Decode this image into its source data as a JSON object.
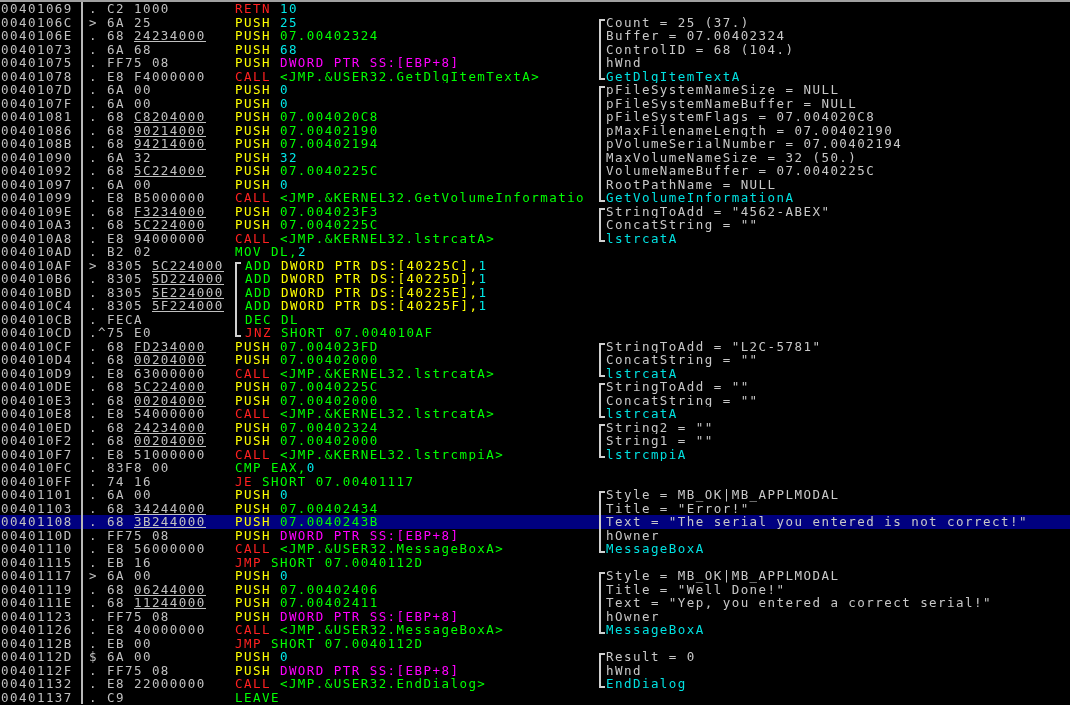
{
  "rows": [
    {
      "address": "00401069",
      "mark": ".",
      "opcode": "C2",
      "bytes": "1000",
      "mnemonic": "RETN",
      "kind": "ret",
      "operand": [
        {
          "text": "10",
          "kind": "const"
        }
      ],
      "selected": false
    },
    {
      "address": "0040106C",
      "mark": ">",
      "opcode": "6A",
      "bytes": "25",
      "mnemonic": "PUSH",
      "kind": "push",
      "operand": [
        {
          "text": "25",
          "kind": "const"
        }
      ],
      "comment": {
        "text": "Count = 25 (37.)",
        "kind": "arg"
      },
      "selected": false
    },
    {
      "address": "0040106E",
      "mark": ".",
      "opcode": "68",
      "bytes": "24234000",
      "fixup": true,
      "mnemonic": "PUSH",
      "kind": "push",
      "operand": [
        {
          "text": "07.00402324",
          "kind": "addr"
        }
      ],
      "comment": {
        "text": "Buffer = 07.00402324",
        "kind": "arg"
      },
      "selected": false
    },
    {
      "address": "00401073",
      "mark": ".",
      "opcode": "6A",
      "bytes": "68",
      "mnemonic": "PUSH",
      "kind": "push",
      "operand": [
        {
          "text": "68",
          "kind": "const"
        }
      ],
      "comment": {
        "text": "ControlID = 68 (104.)",
        "kind": "arg"
      },
      "selected": false
    },
    {
      "address": "00401075",
      "mark": ".",
      "opcode": "FF75",
      "bytes": "08",
      "mnemonic": "PUSH",
      "kind": "push",
      "operand": [
        {
          "text": "DWORD PTR SS:[EBP+8]",
          "kind": "stack"
        }
      ],
      "comment": {
        "text": "hWnd",
        "kind": "arg"
      },
      "selected": false
    },
    {
      "address": "00401078",
      "mark": ".",
      "opcode": "E8",
      "bytes": "F4000000",
      "mnemonic": "CALL",
      "kind": "call",
      "operand": [
        {
          "text": "<JMP.&USER32.GetDlgItemTextA>",
          "kind": "addr"
        }
      ],
      "comment": {
        "text": "GetDlgItemTextA",
        "kind": "func"
      },
      "selected": false
    },
    {
      "address": "0040107D",
      "mark": ".",
      "opcode": "6A",
      "bytes": "00",
      "mnemonic": "PUSH",
      "kind": "push",
      "operand": [
        {
          "text": "0",
          "kind": "const"
        }
      ],
      "comment": {
        "text": "pFileSystemNameSize = NULL",
        "kind": "arg"
      },
      "selected": false
    },
    {
      "address": "0040107F",
      "mark": ".",
      "opcode": "6A",
      "bytes": "00",
      "mnemonic": "PUSH",
      "kind": "push",
      "operand": [
        {
          "text": "0",
          "kind": "const"
        }
      ],
      "comment": {
        "text": "pFileSystemNameBuffer = NULL",
        "kind": "arg"
      },
      "selected": false
    },
    {
      "address": "00401081",
      "mark": ".",
      "opcode": "68",
      "bytes": "C8204000",
      "fixup": true,
      "mnemonic": "PUSH",
      "kind": "push",
      "operand": [
        {
          "text": "07.004020C8",
          "kind": "addr"
        }
      ],
      "comment": {
        "text": "pFileSystemFlags = 07.004020C8",
        "kind": "arg"
      },
      "selected": false
    },
    {
      "address": "00401086",
      "mark": ".",
      "opcode": "68",
      "bytes": "90214000",
      "fixup": true,
      "mnemonic": "PUSH",
      "kind": "push",
      "operand": [
        {
          "text": "07.00402190",
          "kind": "addr"
        }
      ],
      "comment": {
        "text": "pMaxFilenameLength = 07.00402190",
        "kind": "arg"
      },
      "selected": false
    },
    {
      "address": "0040108B",
      "mark": ".",
      "opcode": "68",
      "bytes": "94214000",
      "fixup": true,
      "mnemonic": "PUSH",
      "kind": "push",
      "operand": [
        {
          "text": "07.00402194",
          "kind": "addr"
        }
      ],
      "comment": {
        "text": "pVolumeSerialNumber = 07.00402194",
        "kind": "arg"
      },
      "selected": false
    },
    {
      "address": "00401090",
      "mark": ".",
      "opcode": "6A",
      "bytes": "32",
      "mnemonic": "PUSH",
      "kind": "push",
      "operand": [
        {
          "text": "32",
          "kind": "const"
        }
      ],
      "comment": {
        "text": "MaxVolumeNameSize = 32 (50.)",
        "kind": "arg"
      },
      "selected": false
    },
    {
      "address": "00401092",
      "mark": ".",
      "opcode": "68",
      "bytes": "5C224000",
      "fixup": true,
      "mnemonic": "PUSH",
      "kind": "push",
      "operand": [
        {
          "text": "07.0040225C",
          "kind": "addr"
        }
      ],
      "comment": {
        "text": "VolumeNameBuffer = 07.0040225C",
        "kind": "arg"
      },
      "selected": false
    },
    {
      "address": "00401097",
      "mark": ".",
      "opcode": "6A",
      "bytes": "00",
      "mnemonic": "PUSH",
      "kind": "push",
      "operand": [
        {
          "text": "0",
          "kind": "const"
        }
      ],
      "comment": {
        "text": "RootPathName = NULL",
        "kind": "arg"
      },
      "selected": false
    },
    {
      "address": "00401099",
      "mark": ".",
      "opcode": "E8",
      "bytes": "B5000000",
      "mnemonic": "CALL",
      "kind": "call",
      "operand": [
        {
          "text": "<JMP.&KERNEL32.GetVolumeInformatio",
          "kind": "addr"
        }
      ],
      "comment": {
        "text": "GetVolumeInformationA",
        "kind": "func"
      },
      "selected": false
    },
    {
      "address": "0040109E",
      "mark": ".",
      "opcode": "68",
      "bytes": "F3234000",
      "fixup": true,
      "mnemonic": "PUSH",
      "kind": "push",
      "operand": [
        {
          "text": "07.004023F3",
          "kind": "addr"
        }
      ],
      "comment": {
        "text": "StringToAdd = \"4562-ABEX\"",
        "kind": "arg"
      },
      "selected": false
    },
    {
      "address": "004010A3",
      "mark": ".",
      "opcode": "68",
      "bytes": "5C224000",
      "fixup": true,
      "mnemonic": "PUSH",
      "kind": "push",
      "operand": [
        {
          "text": "07.0040225C",
          "kind": "addr"
        }
      ],
      "comment": {
        "text": "ConcatString = \"\"",
        "kind": "arg"
      },
      "selected": false
    },
    {
      "address": "004010A8",
      "mark": ".",
      "opcode": "E8",
      "bytes": "94000000",
      "mnemonic": "CALL",
      "kind": "call",
      "operand": [
        {
          "text": "<JMP.&KERNEL32.lstrcatA>",
          "kind": "addr"
        }
      ],
      "comment": {
        "text": "lstrcatA",
        "kind": "func"
      },
      "selected": false
    },
    {
      "address": "004010AD",
      "mark": ".",
      "opcode": "B2",
      "bytes": "02",
      "mnemonic": "MOV",
      "kind": "other",
      "operand": [
        {
          "text": "DL,",
          "kind": "reg"
        },
        {
          "text": "2",
          "kind": "const"
        }
      ],
      "selected": false
    },
    {
      "address": "004010AF",
      "mark": ">",
      "opcode": "8305",
      "bytes": "5C224000",
      "fixup": true,
      "mnemonic": "ADD",
      "kind": "other",
      "loop": true,
      "operand": [
        {
          "text": "DWORD PTR DS:[40225C],",
          "kind": "mem"
        },
        {
          "text": "1",
          "kind": "const"
        }
      ],
      "selected": false
    },
    {
      "address": "004010B6",
      "mark": ".",
      "opcode": "8305",
      "bytes": "5D224000",
      "fixup": true,
      "mnemonic": "ADD",
      "kind": "other",
      "loop": true,
      "operand": [
        {
          "text": "DWORD PTR DS:[40225D],",
          "kind": "mem"
        },
        {
          "text": "1",
          "kind": "const"
        }
      ],
      "selected": false
    },
    {
      "address": "004010BD",
      "mark": ".",
      "opcode": "8305",
      "bytes": "5E224000",
      "fixup": true,
      "mnemonic": "ADD",
      "kind": "other",
      "loop": true,
      "operand": [
        {
          "text": "DWORD PTR DS:[40225E],",
          "kind": "mem"
        },
        {
          "text": "1",
          "kind": "const"
        }
      ],
      "selected": false
    },
    {
      "address": "004010C4",
      "mark": ".",
      "opcode": "8305",
      "bytes": "5F224000",
      "fixup": true,
      "mnemonic": "ADD",
      "kind": "other",
      "loop": true,
      "operand": [
        {
          "text": "DWORD PTR DS:[40225F],",
          "kind": "mem"
        },
        {
          "text": "1",
          "kind": "const"
        }
      ],
      "selected": false
    },
    {
      "address": "004010CB",
      "mark": ".",
      "opcode": "FECA",
      "mnemonic": "DEC",
      "kind": "other",
      "loop": true,
      "operand": [
        {
          "text": "DL",
          "kind": "reg"
        }
      ],
      "selected": false
    },
    {
      "address": "004010CD",
      "mark": ".^",
      "opcode": "75",
      "bytes": "E0",
      "mnemonic": "JNZ",
      "kind": "jump",
      "loop": true,
      "operand": [
        {
          "text": "SHORT 07.004010AF",
          "kind": "addr"
        }
      ],
      "selected": false
    },
    {
      "address": "004010CF",
      "mark": ".",
      "opcode": "68",
      "bytes": "FD234000",
      "fixup": true,
      "mnemonic": "PUSH",
      "kind": "push",
      "operand": [
        {
          "text": "07.004023FD",
          "kind": "addr"
        }
      ],
      "comment": {
        "text": "StringToAdd = \"L2C-5781\"",
        "kind": "arg"
      },
      "selected": false
    },
    {
      "address": "004010D4",
      "mark": ".",
      "opcode": "68",
      "bytes": "00204000",
      "fixup": true,
      "mnemonic": "PUSH",
      "kind": "push",
      "operand": [
        {
          "text": "07.00402000",
          "kind": "addr"
        }
      ],
      "comment": {
        "text": "ConcatString = \"\"",
        "kind": "arg"
      },
      "selected": false
    },
    {
      "address": "004010D9",
      "mark": ".",
      "opcode": "E8",
      "bytes": "63000000",
      "mnemonic": "CALL",
      "kind": "call",
      "operand": [
        {
          "text": "<JMP.&KERNEL32.lstrcatA>",
          "kind": "addr"
        }
      ],
      "comment": {
        "text": "lstrcatA",
        "kind": "func"
      },
      "selected": false
    },
    {
      "address": "004010DE",
      "mark": ".",
      "opcode": "68",
      "bytes": "5C224000",
      "fixup": true,
      "mnemonic": "PUSH",
      "kind": "push",
      "operand": [
        {
          "text": "07.0040225C",
          "kind": "addr"
        }
      ],
      "comment": {
        "text": "StringToAdd = \"\"",
        "kind": "arg"
      },
      "selected": false
    },
    {
      "address": "004010E3",
      "mark": ".",
      "opcode": "68",
      "bytes": "00204000",
      "fixup": true,
      "mnemonic": "PUSH",
      "kind": "push",
      "operand": [
        {
          "text": "07.00402000",
          "kind": "addr"
        }
      ],
      "comment": {
        "text": "ConcatString = \"\"",
        "kind": "arg"
      },
      "selected": false
    },
    {
      "address": "004010E8",
      "mark": ".",
      "opcode": "E8",
      "bytes": "54000000",
      "mnemonic": "CALL",
      "kind": "call",
      "operand": [
        {
          "text": "<JMP.&KERNEL32.lstrcatA>",
          "kind": "addr"
        }
      ],
      "comment": {
        "text": "lstrcatA",
        "kind": "func"
      },
      "selected": false
    },
    {
      "address": "004010ED",
      "mark": ".",
      "opcode": "68",
      "bytes": "24234000",
      "fixup": true,
      "mnemonic": "PUSH",
      "kind": "push",
      "operand": [
        {
          "text": "07.00402324",
          "kind": "addr"
        }
      ],
      "comment": {
        "text": "String2 = \"\"",
        "kind": "arg"
      },
      "selected": false
    },
    {
      "address": "004010F2",
      "mark": ".",
      "opcode": "68",
      "bytes": "00204000",
      "fixup": true,
      "mnemonic": "PUSH",
      "kind": "push",
      "operand": [
        {
          "text": "07.00402000",
          "kind": "addr"
        }
      ],
      "comment": {
        "text": "String1 = \"\"",
        "kind": "arg"
      },
      "selected": false
    },
    {
      "address": "004010F7",
      "mark": ".",
      "opcode": "E8",
      "bytes": "51000000",
      "mnemonic": "CALL",
      "kind": "call",
      "operand": [
        {
          "text": "<JMP.&KERNEL32.lstrcmpiA>",
          "kind": "addr"
        }
      ],
      "comment": {
        "text": "lstrcmpiA",
        "kind": "func"
      },
      "selected": false
    },
    {
      "address": "004010FC",
      "mark": ".",
      "opcode": "83F8",
      "bytes": "00",
      "mnemonic": "CMP",
      "kind": "other",
      "operand": [
        {
          "text": "EAX,",
          "kind": "reg"
        },
        {
          "text": "0",
          "kind": "const"
        }
      ],
      "selected": false
    },
    {
      "address": "004010FF",
      "mark": ".",
      "opcode": "74",
      "bytes": "16",
      "mnemonic": "JE",
      "kind": "jump",
      "operand": [
        {
          "text": "SHORT 07.00401117",
          "kind": "addr"
        }
      ],
      "selected": false
    },
    {
      "address": "00401101",
      "mark": ".",
      "opcode": "6A",
      "bytes": "00",
      "mnemonic": "PUSH",
      "kind": "push",
      "operand": [
        {
          "text": "0",
          "kind": "const"
        }
      ],
      "comment": {
        "text": "Style = MB_OK|MB_APPLMODAL",
        "kind": "arg"
      },
      "selected": false
    },
    {
      "address": "00401103",
      "mark": ".",
      "opcode": "68",
      "bytes": "34244000",
      "fixup": true,
      "mnemonic": "PUSH",
      "kind": "push",
      "operand": [
        {
          "text": "07.00402434",
          "kind": "addr"
        }
      ],
      "comment": {
        "text": "Title = \"Error!\"",
        "kind": "arg"
      },
      "selected": false
    },
    {
      "address": "00401108",
      "mark": ".",
      "opcode": "68",
      "bytes": "3B244000",
      "fixup": true,
      "mnemonic": "PUSH",
      "kind": "push",
      "operand": [
        {
          "text": "07.0040243B",
          "kind": "addr"
        }
      ],
      "comment": {
        "text": "Text = \"The serial you entered is not correct!\"",
        "kind": "arg"
      },
      "selected": true
    },
    {
      "address": "0040110D",
      "mark": ".",
      "opcode": "FF75",
      "bytes": "08",
      "mnemonic": "PUSH",
      "kind": "push",
      "operand": [
        {
          "text": "DWORD PTR SS:[EBP+8]",
          "kind": "stack"
        }
      ],
      "comment": {
        "text": "hOwner",
        "kind": "arg"
      },
      "selected": false
    },
    {
      "address": "00401110",
      "mark": ".",
      "opcode": "E8",
      "bytes": "56000000",
      "mnemonic": "CALL",
      "kind": "call",
      "operand": [
        {
          "text": "<JMP.&USER32.MessageBoxA>",
          "kind": "addr"
        }
      ],
      "comment": {
        "text": "MessageBoxA",
        "kind": "func"
      },
      "selected": false
    },
    {
      "address": "00401115",
      "mark": ".",
      "opcode": "EB",
      "bytes": "16",
      "mnemonic": "JMP",
      "kind": "jump",
      "operand": [
        {
          "text": "SHORT 07.0040112D",
          "kind": "addr"
        }
      ],
      "selected": false
    },
    {
      "address": "00401117",
      "mark": ">",
      "opcode": "6A",
      "bytes": "00",
      "mnemonic": "PUSH",
      "kind": "push",
      "operand": [
        {
          "text": "0",
          "kind": "const"
        }
      ],
      "comment": {
        "text": "Style = MB_OK|MB_APPLMODAL",
        "kind": "arg"
      },
      "selected": false
    },
    {
      "address": "00401119",
      "mark": ".",
      "opcode": "68",
      "bytes": "06244000",
      "fixup": true,
      "mnemonic": "PUSH",
      "kind": "push",
      "operand": [
        {
          "text": "07.00402406",
          "kind": "addr"
        }
      ],
      "comment": {
        "text": "Title = \"Well Done!\"",
        "kind": "arg"
      },
      "selected": false
    },
    {
      "address": "0040111E",
      "mark": ".",
      "opcode": "68",
      "bytes": "11244000",
      "fixup": true,
      "mnemonic": "PUSH",
      "kind": "push",
      "operand": [
        {
          "text": "07.00402411",
          "kind": "addr"
        }
      ],
      "comment": {
        "text": "Text = \"Yep, you entered a correct serial!\"",
        "kind": "arg"
      },
      "selected": false
    },
    {
      "address": "00401123",
      "mark": ".",
      "opcode": "FF75",
      "bytes": "08",
      "mnemonic": "PUSH",
      "kind": "push",
      "operand": [
        {
          "text": "DWORD PTR SS:[EBP+8]",
          "kind": "stack"
        }
      ],
      "comment": {
        "text": "hOwner",
        "kind": "arg"
      },
      "selected": false
    },
    {
      "address": "00401126",
      "mark": ".",
      "opcode": "E8",
      "bytes": "40000000",
      "mnemonic": "CALL",
      "kind": "call",
      "operand": [
        {
          "text": "<JMP.&USER32.MessageBoxA>",
          "kind": "addr"
        }
      ],
      "comment": {
        "text": "MessageBoxA",
        "kind": "func"
      },
      "selected": false
    },
    {
      "address": "0040112B",
      "mark": ".",
      "opcode": "EB",
      "bytes": "00",
      "mnemonic": "JMP",
      "kind": "jump",
      "operand": [
        {
          "text": "SHORT 07.0040112D",
          "kind": "addr"
        }
      ],
      "selected": false
    },
    {
      "address": "0040112D",
      "mark": "$",
      "opcode": "6A",
      "bytes": "00",
      "mnemonic": "PUSH",
      "kind": "push",
      "operand": [
        {
          "text": "0",
          "kind": "const"
        }
      ],
      "comment": {
        "text": "Result = 0",
        "kind": "arg"
      },
      "selected": false
    },
    {
      "address": "0040112F",
      "mark": ".",
      "opcode": "FF75",
      "bytes": "08",
      "mnemonic": "PUSH",
      "kind": "push",
      "operand": [
        {
          "text": "DWORD PTR SS:[EBP+8]",
          "kind": "stack"
        }
      ],
      "comment": {
        "text": "hWnd",
        "kind": "arg"
      },
      "selected": false
    },
    {
      "address": "00401132",
      "mark": ".",
      "opcode": "E8",
      "bytes": "22000000",
      "mnemonic": "CALL",
      "kind": "call",
      "operand": [
        {
          "text": "<JMP.&USER32.EndDialog>",
          "kind": "addr"
        }
      ],
      "comment": {
        "text": "EndDialog",
        "kind": "func"
      },
      "selected": false
    },
    {
      "address": "00401137",
      "mark": ".",
      "opcode": "C9",
      "mnemonic": "LEAVE",
      "kind": "other",
      "selected": false
    }
  ]
}
